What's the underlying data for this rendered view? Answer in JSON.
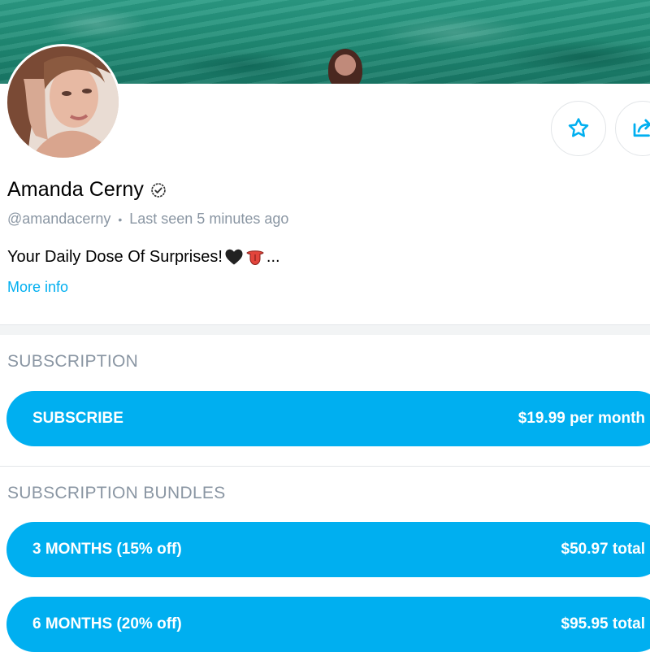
{
  "profile": {
    "name": "Amanda Cerny",
    "handle": "@amandacerny",
    "separator": "•",
    "last_seen": "Last seen 5 minutes ago",
    "bio": "Your Daily Dose Of Surprises!",
    "bio_ellipsis": "...",
    "more_info": "More info"
  },
  "icons": {
    "verified": "verified-check-icon",
    "star": "star-icon",
    "share": "share-icon",
    "bio_emoji_1": "black-heart-emoji",
    "bio_emoji_2": "tongue-emoji"
  },
  "subscription": {
    "section_title": "SUBSCRIPTION",
    "subscribe_label": "SUBSCRIBE",
    "subscribe_price": "$19.99 per month"
  },
  "bundles": {
    "section_title": "SUBSCRIPTION BUNDLES",
    "items": [
      {
        "label": "3 MONTHS (15% off)",
        "price": "$50.97 total"
      },
      {
        "label": "6 MONTHS (20% off)",
        "price": "$95.95 total"
      }
    ]
  },
  "colors": {
    "accent": "#00aff0",
    "muted_text": "#8a96a3",
    "cover_water": "#1f8a74"
  }
}
